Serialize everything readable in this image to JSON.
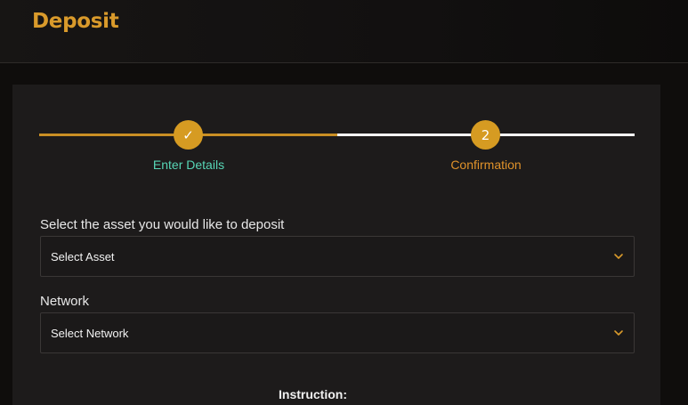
{
  "header": {
    "title": "Deposit"
  },
  "stepper": {
    "steps": [
      {
        "label": "Enter Details",
        "marker": "✓",
        "state": "completed"
      },
      {
        "label": "Confirmation",
        "marker": "2",
        "state": "current"
      }
    ]
  },
  "form": {
    "asset": {
      "label": "Select the asset you would like to deposit",
      "value": "Select Asset"
    },
    "network": {
      "label": "Network",
      "value": "Select Network"
    }
  },
  "instruction": {
    "heading": "Instruction:"
  },
  "colors": {
    "accent": "#d99a2b",
    "completed_label": "#57d6b6",
    "current_label": "#e0922a",
    "background": "#0f0d0c",
    "card": "#1d1b1b"
  }
}
